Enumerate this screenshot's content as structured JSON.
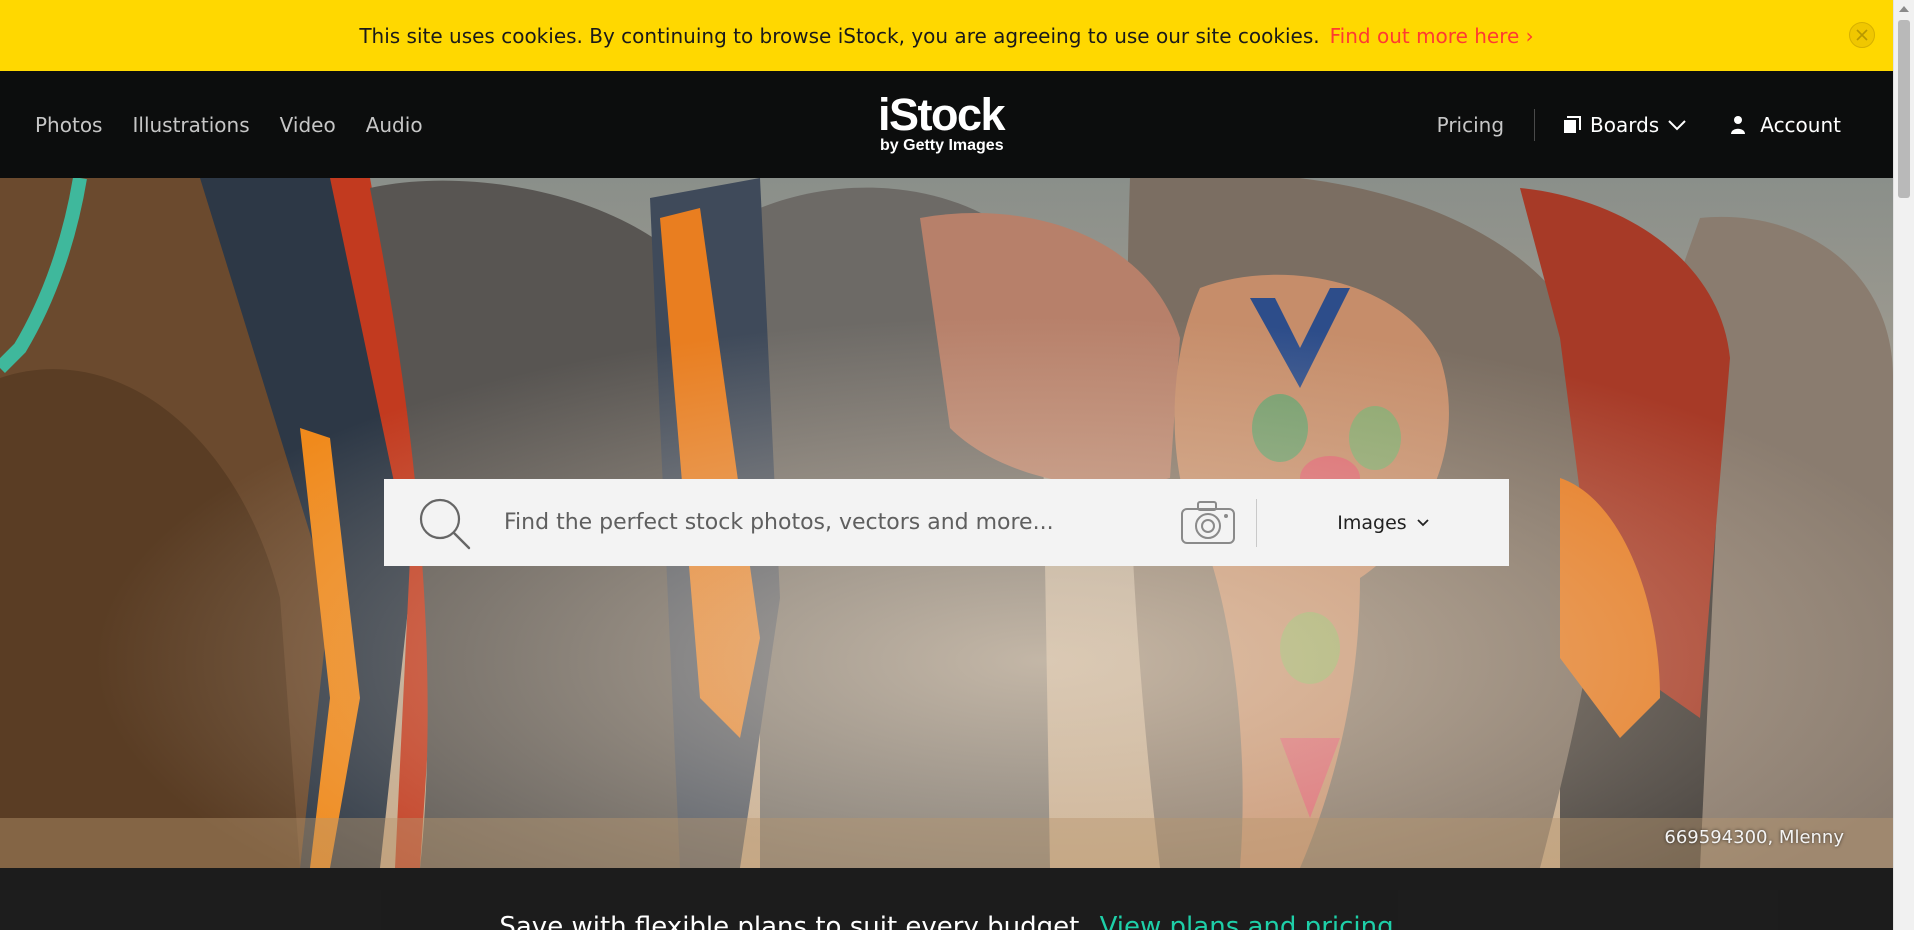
{
  "cookie": {
    "message": "This site uses cookies. By continuing to browse iStock, you are agreeing to use our site cookies.",
    "link_label": "Find out more here ›"
  },
  "header": {
    "nav": [
      "Photos",
      "Illustrations",
      "Video",
      "Audio"
    ],
    "logo": {
      "brand": "iStock",
      "sub": "by Getty Images"
    },
    "pricing_label": "Pricing",
    "boards_label": "Boards",
    "account_label": "Account"
  },
  "search": {
    "placeholder": "Find the perfect stock photos, vectors and more...",
    "type_label": "Images"
  },
  "hero": {
    "credit": "669594300, Mlenny"
  },
  "promo": {
    "text": "Save with flexible plans to suit every budget.",
    "link_label": "View plans and pricing"
  },
  "colors": {
    "cookie_bar": "#ffd800",
    "cookie_link": "#ff3b30",
    "header_bg": "#0c0d0d",
    "promo_link": "#1ecfa8"
  },
  "icons": {
    "search": "magnifier-icon",
    "camera": "camera-icon",
    "boards": "boards-icon",
    "account": "person-icon",
    "chevron": "chevron-down-icon",
    "close": "close-icon"
  }
}
